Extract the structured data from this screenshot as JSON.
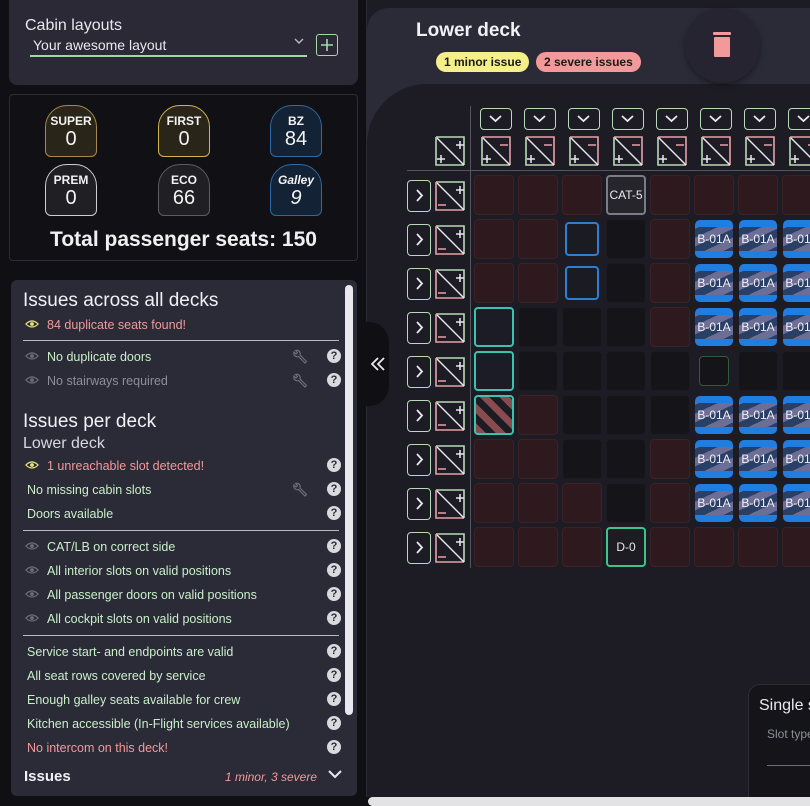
{
  "layouts": {
    "title": "Cabin layouts",
    "selected": "Your awesome layout",
    "add_icon": "plus-icon"
  },
  "seat_counts": [
    {
      "label": "SUPER",
      "value": "0",
      "style": "gold"
    },
    {
      "label": "FIRST",
      "value": "0",
      "style": "gold2"
    },
    {
      "label": "BZ",
      "value": "84",
      "style": "blue"
    },
    {
      "label": "PREM",
      "value": "0",
      "style": "white"
    },
    {
      "label": "ECO",
      "value": "66",
      "style": "grey"
    },
    {
      "label": "Galley",
      "value": "9",
      "style": "blue"
    }
  ],
  "total_seats": "Total passenger seats: 150",
  "issues": {
    "all_decks_title": "Issues across all decks",
    "all_decks": [
      {
        "text": "84 duplicate seats found!",
        "status": "error",
        "eye": "active"
      },
      {
        "text": "No duplicate doors",
        "status": "ok",
        "eye": "inactive",
        "wrench": true,
        "help": true
      },
      {
        "text": "No stairways required",
        "status": "disabled",
        "eye": "inactive",
        "wrench": true,
        "help": true
      }
    ],
    "per_deck_title": "Issues per deck",
    "deck_name": "Lower deck",
    "group1": [
      {
        "text": "1 unreachable slot detected!",
        "status": "error",
        "eye": "active",
        "help": true
      },
      {
        "text": "No missing cabin slots",
        "status": "ok",
        "wrench": true,
        "help": true
      },
      {
        "text": "Doors available",
        "status": "ok",
        "help": true
      }
    ],
    "group2": [
      {
        "text": "CAT/LB on correct side",
        "status": "ok",
        "eye": "inactive",
        "help": true
      },
      {
        "text": "All interior slots on valid positions",
        "status": "ok",
        "eye": "inactive",
        "help": true
      },
      {
        "text": "All passenger doors on valid positions",
        "status": "ok",
        "eye": "inactive",
        "help": true
      },
      {
        "text": "All cockpit slots on valid positions",
        "status": "ok",
        "eye": "inactive",
        "help": true
      }
    ],
    "group3": [
      {
        "text": "Service start- and endpoints are valid",
        "status": "ok",
        "help": true
      },
      {
        "text": "All seat rows covered by service",
        "status": "ok",
        "help": true
      },
      {
        "text": "Enough galley seats available for crew",
        "status": "ok",
        "help": true
      },
      {
        "text": "Kitchen accessible (In-Flight services available)",
        "status": "ok",
        "help": true
      },
      {
        "text": "No intercom on this deck!",
        "status": "error",
        "help": true
      }
    ],
    "footer_label": "Issues",
    "footer_summary": "1 minor, 3 severe",
    "help_glyph": "?"
  },
  "deck": {
    "title": "Lower deck",
    "minor_pill": "1 minor issue",
    "severe_pill": "2 severe issues",
    "collapse_glyph": "«",
    "grid": [
      [
        "red",
        "red",
        "red",
        "cat",
        "red",
        "red",
        "red",
        "red"
      ],
      [
        "red",
        "red",
        "blue-out",
        "dark",
        "red",
        "bz",
        "bz",
        "bz"
      ],
      [
        "red",
        "red",
        "blue-out",
        "dark",
        "red",
        "bz",
        "bz",
        "bz"
      ],
      [
        "teal",
        "dark",
        "dark",
        "dark",
        "red",
        "bz",
        "bz",
        "bz"
      ],
      [
        "teal",
        "dark",
        "dark",
        "dark",
        "dark",
        "green-out",
        "dark",
        "dark"
      ],
      [
        "teal-striped",
        "red",
        "dark",
        "dark",
        "dark",
        "bz",
        "bz",
        "bz"
      ],
      [
        "red",
        "red",
        "dark",
        "dark",
        "red",
        "bz",
        "bz",
        "bz"
      ],
      [
        "red",
        "red",
        "red",
        "dark",
        "red",
        "bz",
        "bz",
        "bz"
      ],
      [
        "red",
        "red",
        "red",
        "door",
        "red",
        "red",
        "red",
        "red"
      ]
    ],
    "labels": {
      "cat": "CAT-5",
      "door": "D-0",
      "bz": "B-01A"
    },
    "row_expand_glyph": ">"
  },
  "single_slot": {
    "title": "Single s",
    "field_label": "Slot type"
  }
}
